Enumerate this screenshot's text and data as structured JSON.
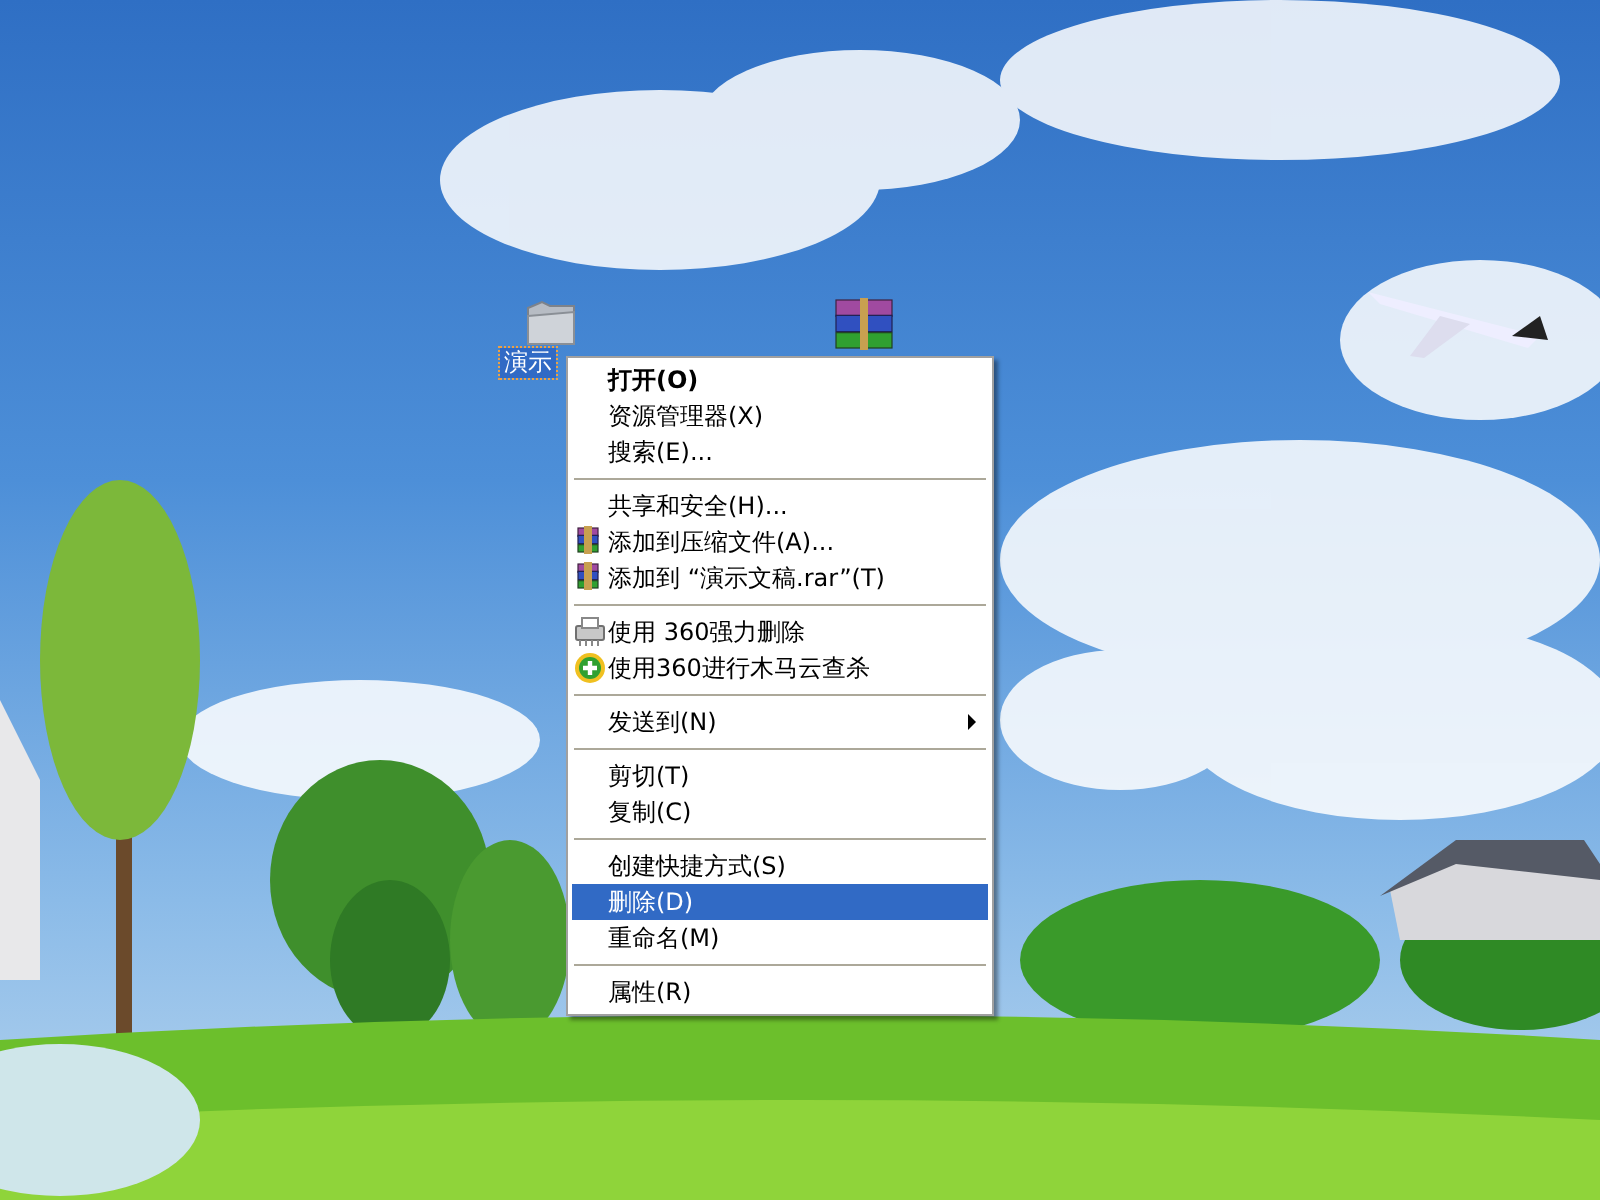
{
  "desktop_icons": [
    {
      "kind": "folder",
      "label": "演示",
      "selected": true
    },
    {
      "kind": "archive",
      "selected": false
    }
  ],
  "context_menu": {
    "items": [
      {
        "kind": "item",
        "label": "打开(O)",
        "bold": true,
        "selected": false
      },
      {
        "kind": "item",
        "label": "资源管理器(X)",
        "selected": false
      },
      {
        "kind": "item",
        "label": "搜索(E)...",
        "selected": false
      },
      {
        "kind": "separator"
      },
      {
        "kind": "item",
        "label": "共享和安全(H)...",
        "selected": false
      },
      {
        "kind": "archive",
        "label": "添加到压缩文件(A)...",
        "selected": false
      },
      {
        "kind": "archive",
        "label": "添加到 “演示文稿.rar”(T)",
        "selected": false
      },
      {
        "kind": "separator"
      },
      {
        "kind": "shredder",
        "label": "使用 360强力删除",
        "selected": false
      },
      {
        "kind": "plus",
        "label": "使用360进行木马云查杀",
        "selected": false
      },
      {
        "kind": "separator"
      },
      {
        "kind": "submenu",
        "label": "发送到(N)",
        "selected": false
      },
      {
        "kind": "separator"
      },
      {
        "kind": "item",
        "label": "剪切(T)",
        "selected": false
      },
      {
        "kind": "item",
        "label": "复制(C)",
        "selected": false
      },
      {
        "kind": "separator"
      },
      {
        "kind": "item",
        "label": "创建快捷方式(S)",
        "selected": false
      },
      {
        "kind": "item",
        "label": "删除(D)",
        "selected": true
      },
      {
        "kind": "item",
        "label": "重命名(M)",
        "selected": false
      },
      {
        "kind": "separator"
      },
      {
        "kind": "item",
        "label": "属性(R)",
        "selected": false
      }
    ]
  }
}
